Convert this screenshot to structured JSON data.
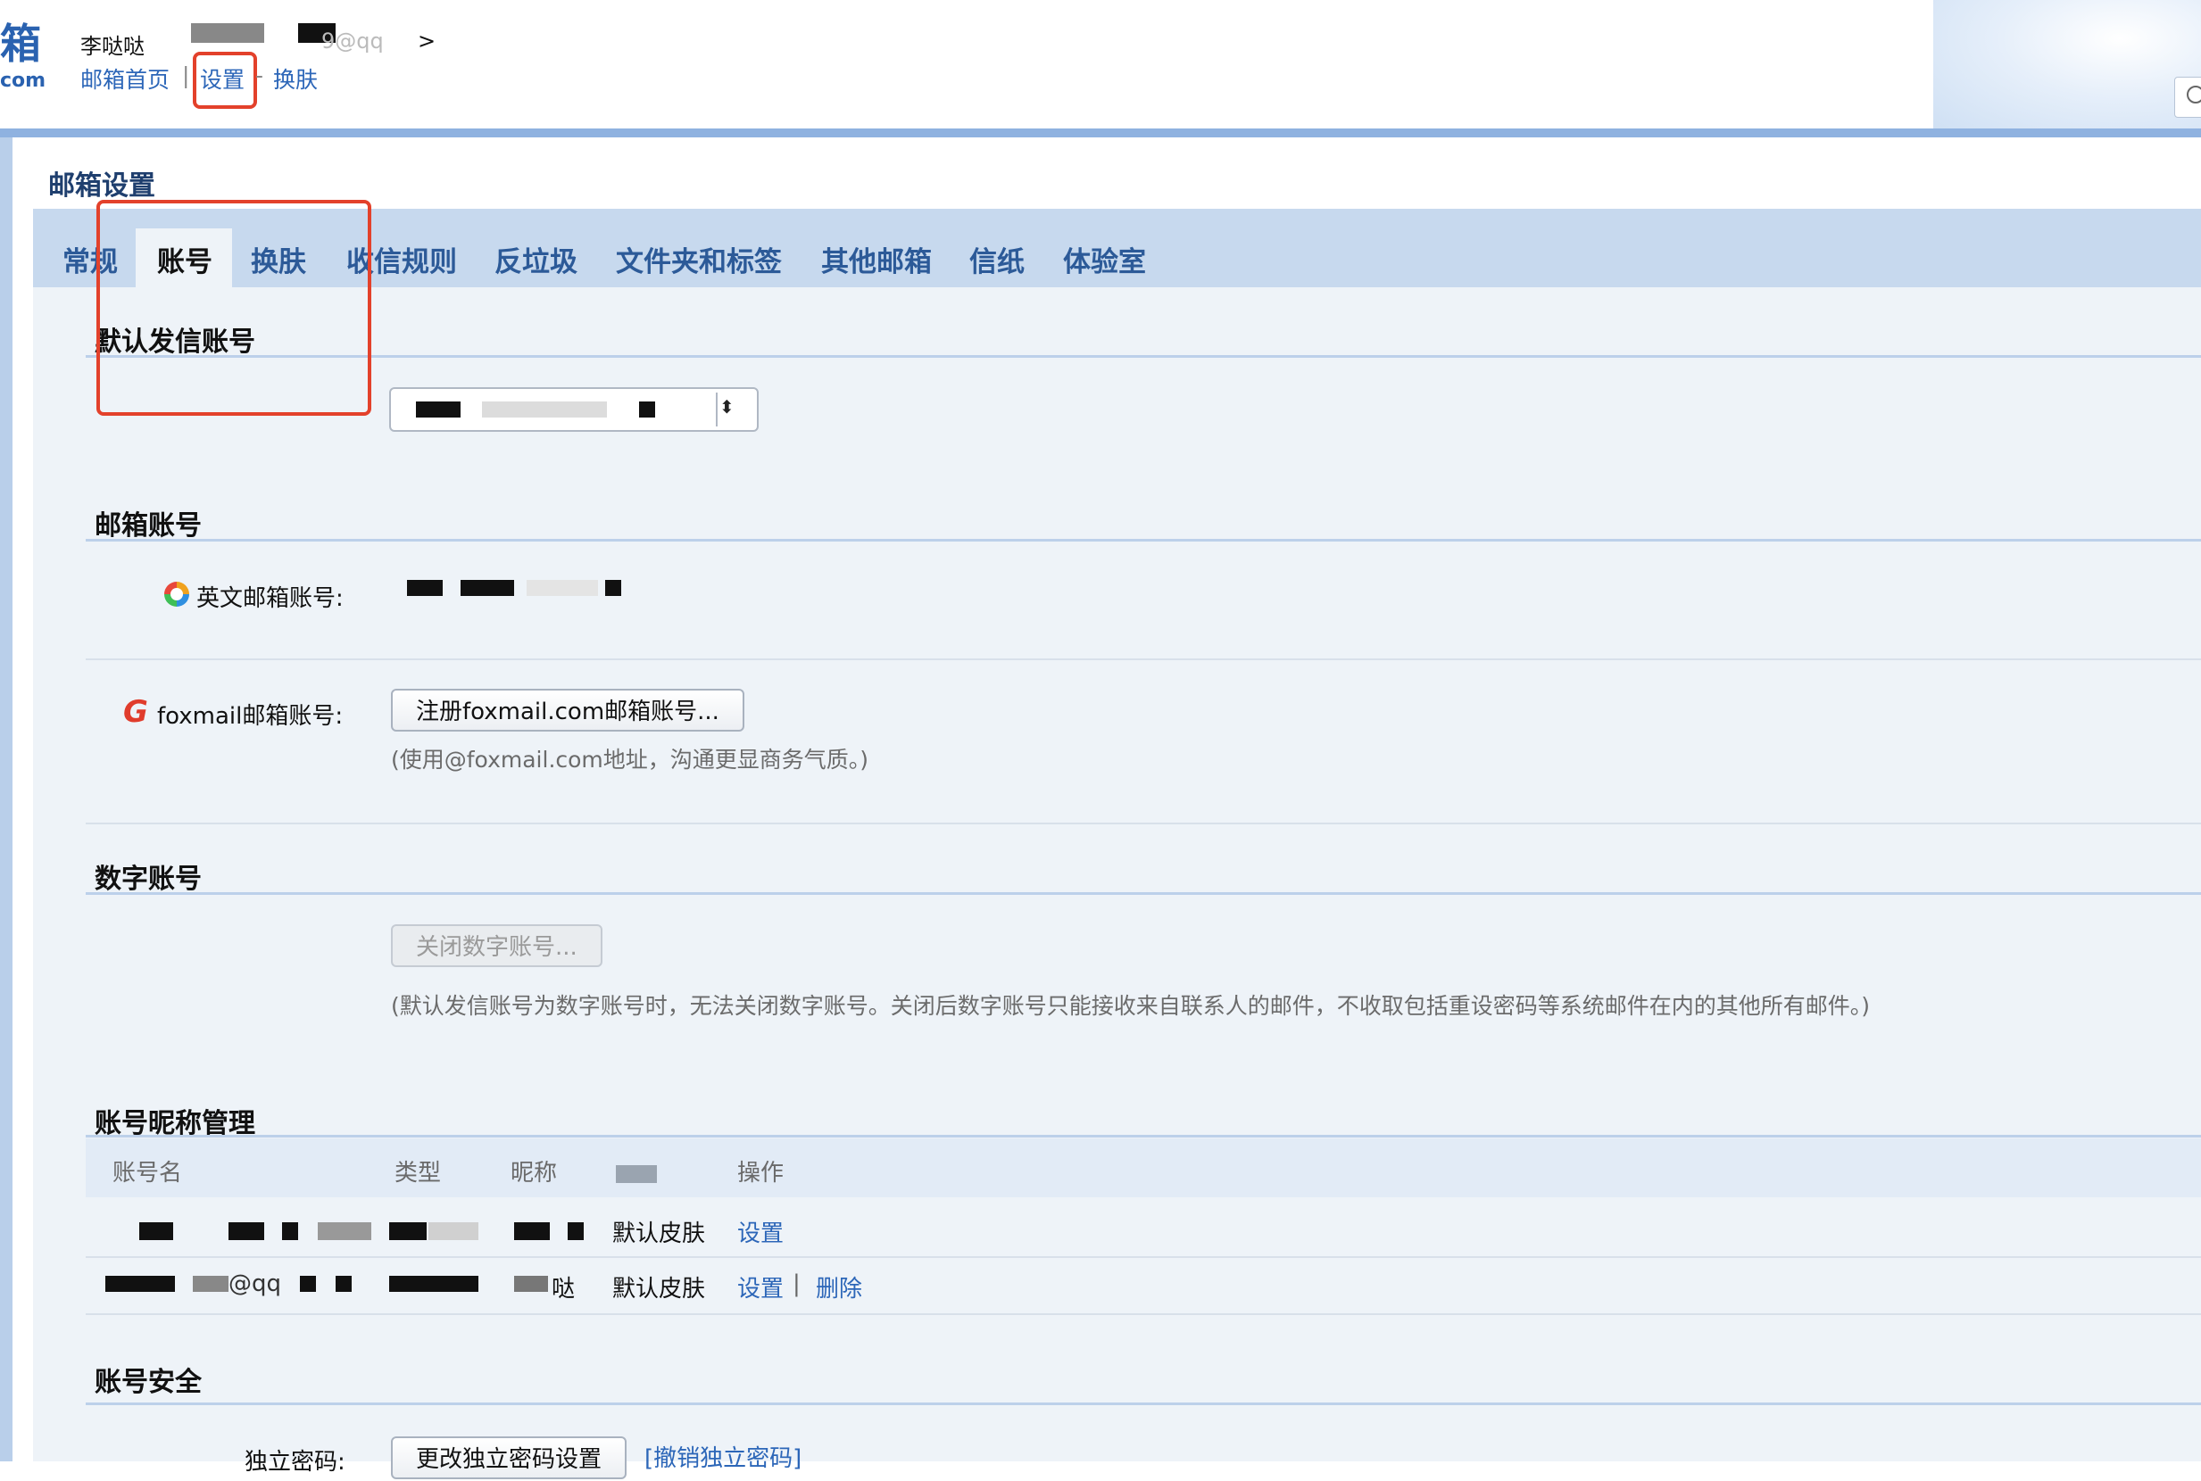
{
  "header": {
    "logo_char": "箱",
    "logo_suffix": "com",
    "user_name": "李哒哒",
    "user_email_fragment": "9@qq",
    "user_arrow": ">",
    "links": {
      "home": "邮箱首页",
      "settings": "设置",
      "skin": "换肤"
    },
    "sep1": "|",
    "sep2": "-"
  },
  "page": {
    "title": "邮箱设置",
    "tabs": [
      "常规",
      "账号",
      "换肤",
      "收信规则",
      "反垃圾",
      "文件夹和标签",
      "其他邮箱",
      "信纸",
      "体验室"
    ],
    "active_tab": "账号"
  },
  "default_sender": {
    "title": "默认发信账号"
  },
  "mail_account": {
    "title": "邮箱账号",
    "english_label": "英文邮箱账号:",
    "foxmail_label": "foxmail邮箱账号:",
    "foxmail_button": "注册foxmail.com邮箱账号...",
    "foxmail_hint": "(使用@foxmail.com地址，沟通更显商务气质。)"
  },
  "digital_account": {
    "title": "数字账号",
    "close_button": "关闭数字账号...",
    "hint": "(默认发信账号为数字账号时，无法关闭数字账号。关闭后数字账号只能接收来自联系人的邮件，不收取包括重设密码等系统邮件在内的其他所有邮件。)"
  },
  "nickname_mgmt": {
    "title": "账号昵称管理",
    "columns": [
      "账号名",
      "类型",
      "昵称",
      "操作"
    ],
    "rows": [
      {
        "name": "",
        "type": "",
        "nickname": "",
        "skin": "默认皮肤",
        "actions": [
          "设置"
        ]
      },
      {
        "name": "@qq",
        "type": "",
        "nickname": "哒",
        "skin": "默认皮肤",
        "actions": [
          "设置",
          "删除"
        ],
        "action_sep": "|"
      }
    ]
  },
  "security": {
    "title": "账号安全",
    "password_label": "独立密码:",
    "change_button": "更改独立密码设置",
    "revoke_link": "[撤销独立密码]"
  },
  "colors": {
    "accent_link": "#2c66b8",
    "tab_bar": "#c7d9ee",
    "content_bg": "#eef3f8",
    "highlight": "#e3412b"
  }
}
